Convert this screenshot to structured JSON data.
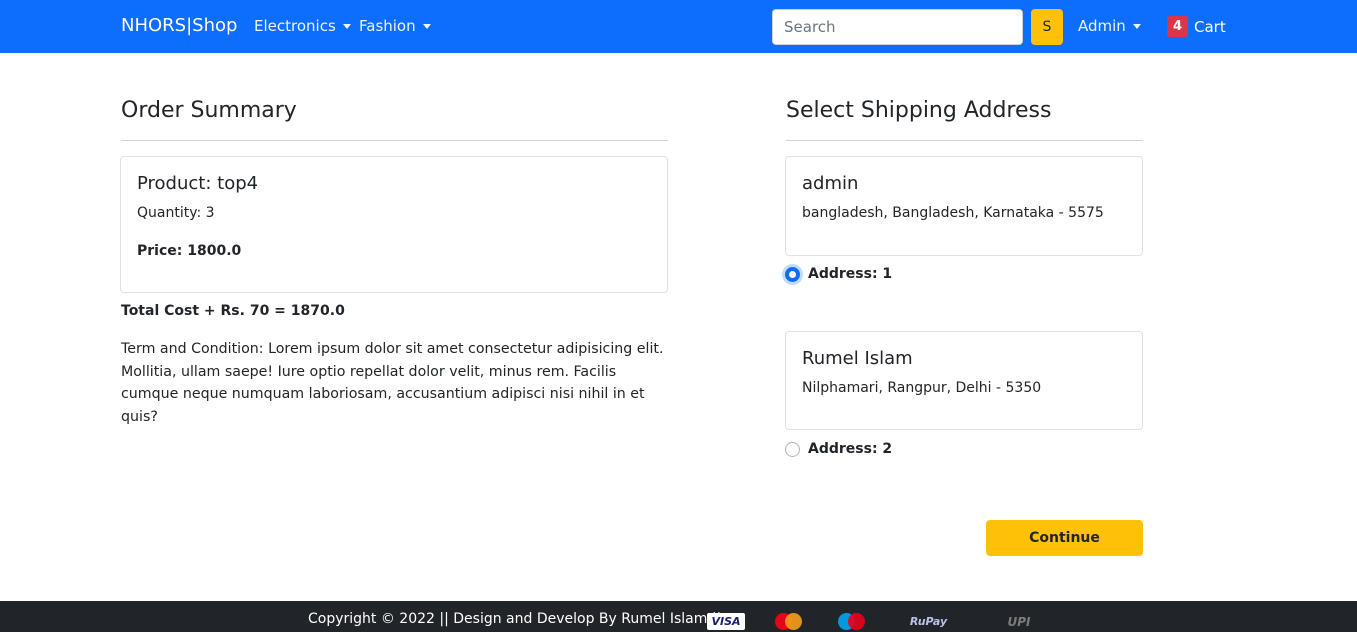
{
  "navbar": {
    "brand": "NHORS|Shop",
    "menus": [
      {
        "label": "Electronics"
      },
      {
        "label": "Fashion"
      }
    ],
    "search_placeholder": "Search",
    "search_button_label": "S",
    "user_menu_label": "Admin",
    "cart_count": "4",
    "cart_label": "Cart",
    "colors": {
      "navbar_bg": "#0d6efd",
      "accent": "#ffc107",
      "badge": "#dc3545"
    }
  },
  "order_summary": {
    "heading": "Order Summary",
    "product_title": "Product: top4",
    "quantity": "Quantity: 3",
    "price": "Price: 1800.0",
    "total": "Total Cost + Rs. 70 = 1870.0",
    "terms": "Term and Condition: Lorem ipsum dolor sit amet consectetur adipisicing elit. Mollitia, ullam saepe! Iure optio repellat dolor velit, minus rem. Facilis cumque neque numquam laboriosam, accusantium adipisci nisi nihil in et quis?"
  },
  "shipping": {
    "heading": "Select Shipping Address",
    "addresses": [
      {
        "name": "admin",
        "address": "bangladesh, Bangladesh, Karnataka - 5575",
        "radio_label": "Address: 1",
        "selected": true
      },
      {
        "name": "Rumel Islam",
        "address": "Nilphamari, Rangpur, Delhi - 5350",
        "radio_label": "Address: 2",
        "selected": false
      }
    ],
    "continue_label": "Continue"
  },
  "footer": {
    "copyright": "Copyright © 2022 || Design and Develop By Rumel Islam ||",
    "payment_logos": {
      "visa": "VISA",
      "mastercard": "MasterCard",
      "maestro": "Maestro",
      "rupay": "RuPay",
      "upi": "UPI"
    }
  }
}
